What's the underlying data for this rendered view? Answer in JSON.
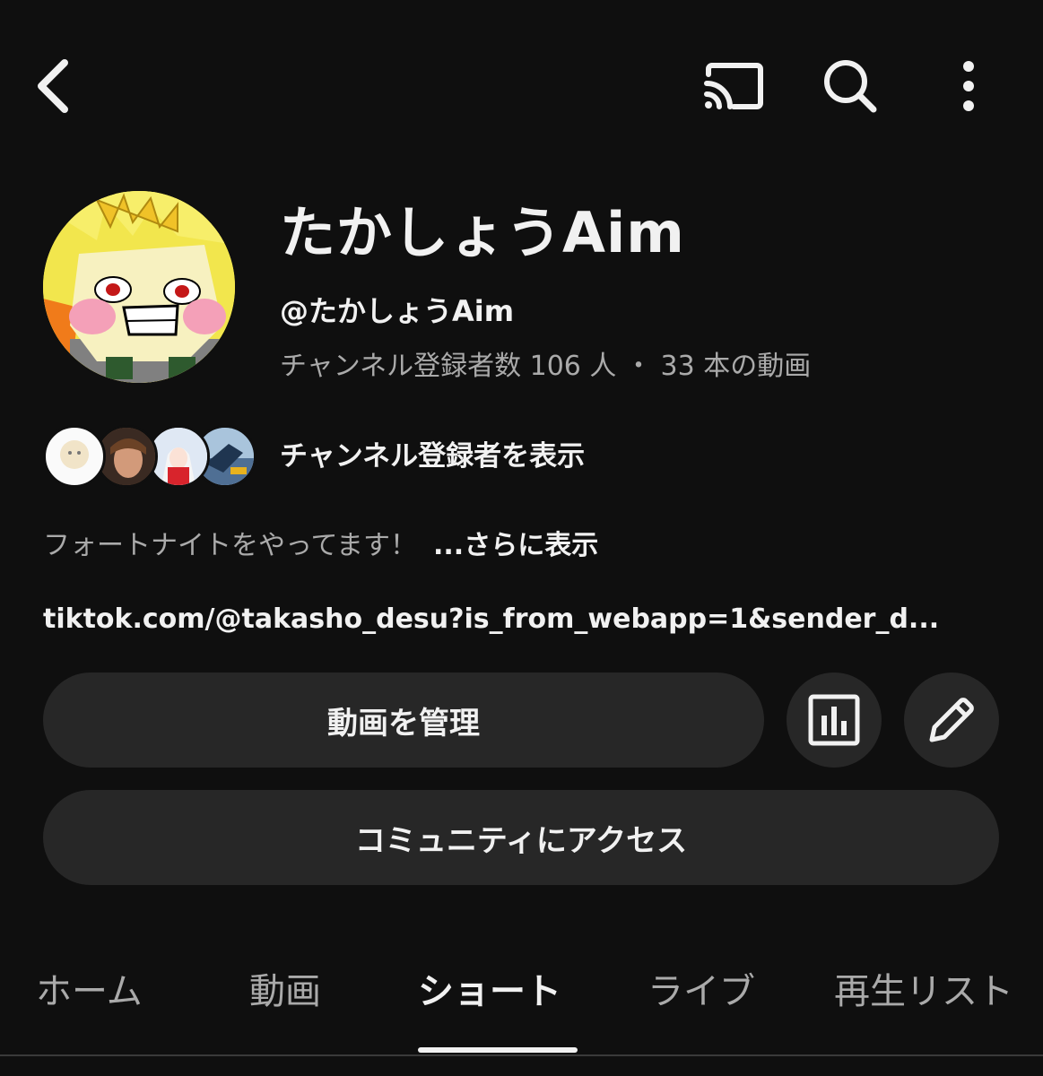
{
  "topbar": {
    "back_icon": "chevron-left-icon",
    "cast_icon": "cast-icon",
    "search_icon": "search-icon",
    "more_icon": "more-vertical-icon"
  },
  "channel": {
    "name": "たかしょうAim",
    "handle": "@たかしょうAim",
    "stats": "チャンネル登録者数 106 人 ・ 33 本の動画"
  },
  "subscribers": {
    "link_label": "チャンネル登録者を表示"
  },
  "description": {
    "text": "フォートナイトをやってます！",
    "more_label": "...さらに表示"
  },
  "external_link": "tiktok.com/@takasho_desu?is_from_webapp=1&sender_d...",
  "actions": {
    "manage_label": "動画を管理",
    "analytics_icon": "analytics-icon",
    "edit_icon": "pencil-icon",
    "community_label": "コミュニティにアクセス"
  },
  "tabs": [
    {
      "label": "ホーム",
      "active": false
    },
    {
      "label": "動画",
      "active": false
    },
    {
      "label": "ショート",
      "active": true
    },
    {
      "label": "ライブ",
      "active": false
    },
    {
      "label": "再生リスト",
      "active": false
    }
  ],
  "colors": {
    "background": "#0f0f0f",
    "surface": "#272727",
    "text_primary": "#f1f1f1",
    "text_secondary": "#aaaaaa"
  }
}
